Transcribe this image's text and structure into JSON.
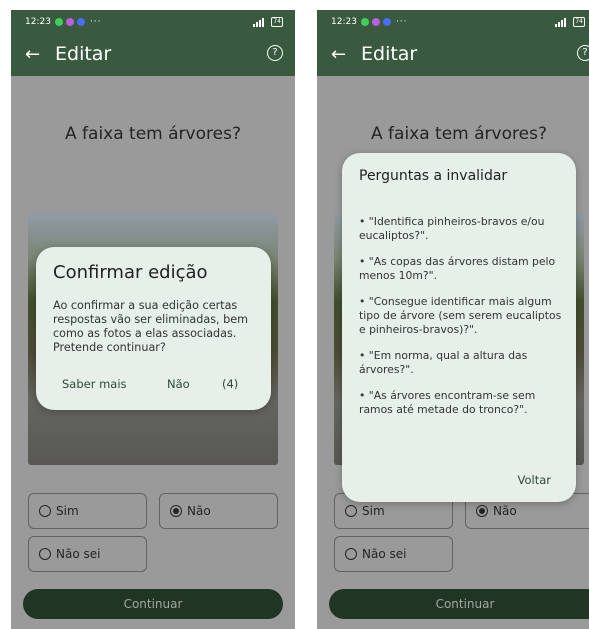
{
  "status": {
    "time": "12:23",
    "battery": "74",
    "more": "···"
  },
  "appbar": {
    "back_glyph": "←",
    "title": "Editar",
    "help_glyph": "?"
  },
  "question": "A faixa tem árvores?",
  "options": {
    "yes": "Sim",
    "no": "Não",
    "dont_know": "Não sei",
    "selected": "Não"
  },
  "continue_label": "Continuar",
  "confirm_dialog": {
    "title": "Confirmar edição",
    "body": "Ao confirmar a sua edição certas respostas vão ser eliminadas, bem como as fotos a elas associadas. Pretende continuar?",
    "learn_more": "Saber mais",
    "no": "Não",
    "yes_countdown": "(4)"
  },
  "invalidate_dialog": {
    "title": "Perguntas a invalidar",
    "items": [
      "• \"Identifica pinheiros-bravos e/ou eucaliptos?\".",
      "• \"As copas das árvores distam pelo menos 10m?\".",
      "• \"Consegue identificar mais algum tipo de árvore (sem serem eucaliptos e pinheiros-bravos)?\".",
      "• \"Em norma, qual a altura das árvores?\".",
      "• \"As árvores encontram-se sem ramos até metade do tronco?\"."
    ],
    "back": "Voltar"
  },
  "colors": {
    "app_bar": "#3a5a40",
    "dialog_bg": "#e6efe8",
    "accent": "#2e4a33"
  }
}
